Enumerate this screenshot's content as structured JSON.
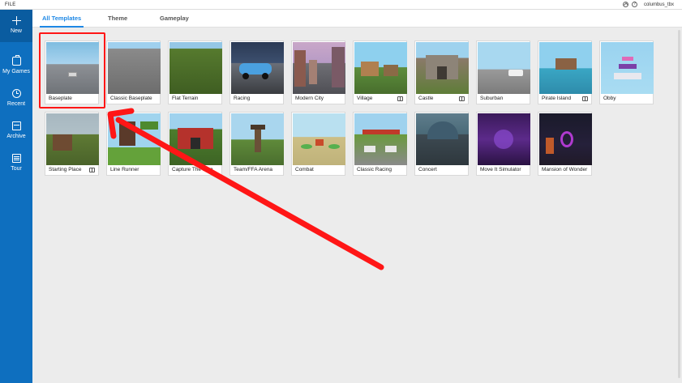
{
  "titlebar": {
    "file_label": "FILE",
    "username": "columbus_tbx"
  },
  "sidebar": {
    "items": [
      {
        "label": "New",
        "icon": "plus-icon"
      },
      {
        "label": "My Games",
        "icon": "briefcase-icon"
      },
      {
        "label": "Recent",
        "icon": "clock-icon"
      },
      {
        "label": "Archive",
        "icon": "archive-icon"
      },
      {
        "label": "Tour",
        "icon": "tour-icon"
      }
    ]
  },
  "tabs": [
    {
      "label": "All Templates"
    },
    {
      "label": "Theme"
    },
    {
      "label": "Gameplay"
    }
  ],
  "templates": [
    {
      "label": "Baseplate"
    },
    {
      "label": "Classic Baseplate"
    },
    {
      "label": "Flat Terrain"
    },
    {
      "label": "Racing"
    },
    {
      "label": "Modern City"
    },
    {
      "label": "Village"
    },
    {
      "label": "Castle"
    },
    {
      "label": "Suburban"
    },
    {
      "label": "Pirate Island"
    },
    {
      "label": "Obby"
    },
    {
      "label": "Starting Place"
    },
    {
      "label": "Line Runner"
    },
    {
      "label": "Capture The Flag"
    },
    {
      "label": "Team/FFA Arena"
    },
    {
      "label": "Combat"
    },
    {
      "label": "Classic Racing"
    },
    {
      "label": "Concert"
    },
    {
      "label": "Move It Simulator"
    },
    {
      "label": "Mansion of Wonder"
    }
  ],
  "colors": {
    "sidebar": "#0e6fbf",
    "accent": "#1e88e5",
    "annotation": "#ff1616"
  }
}
